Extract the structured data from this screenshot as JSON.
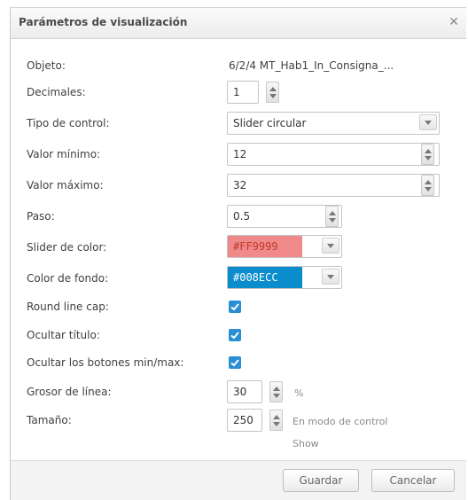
{
  "dialog": {
    "title": "Parámetros de visualización",
    "close_icon": "close-icon"
  },
  "fields": {
    "objeto": {
      "label": "Objeto:",
      "value": "6/2/4 MT_Hab1_In_Consigna_..."
    },
    "decimales": {
      "label": "Decimales:",
      "value": "1"
    },
    "tipo_control": {
      "label": "Tipo de control:",
      "value": "Slider circular"
    },
    "valor_minimo": {
      "label": "Valor mínimo:",
      "value": "12"
    },
    "valor_maximo": {
      "label": "Valor máximo:",
      "value": "32"
    },
    "paso": {
      "label": "Paso:",
      "value": "0.5"
    },
    "slider_color": {
      "label": "Slider de color:",
      "value": "#FF9999",
      "text_color": "#c0392b"
    },
    "color_fondo": {
      "label": "Color de fondo:",
      "value": "#008ECC",
      "text_color": "#ffffff"
    },
    "round_line_cap": {
      "label": "Round line cap:",
      "checked": true
    },
    "ocultar_titulo": {
      "label": "Ocultar título:",
      "checked": true
    },
    "ocultar_botones": {
      "label": "Ocultar los botones min/max:",
      "checked": true
    },
    "grosor_linea": {
      "label": "Grosor de línea:",
      "value": "30",
      "unit": "%"
    },
    "tamano": {
      "label": "Tamaño:",
      "value": "250",
      "note_line1": "En modo de control",
      "note_line2": "Show"
    }
  },
  "footer": {
    "save_label": "Guardar",
    "cancel_label": "Cancelar"
  },
  "colors": {
    "checkbox": "#2a8ed3",
    "slider_swatch": "#f08a8a",
    "background_swatch": "#0b8ccc"
  }
}
